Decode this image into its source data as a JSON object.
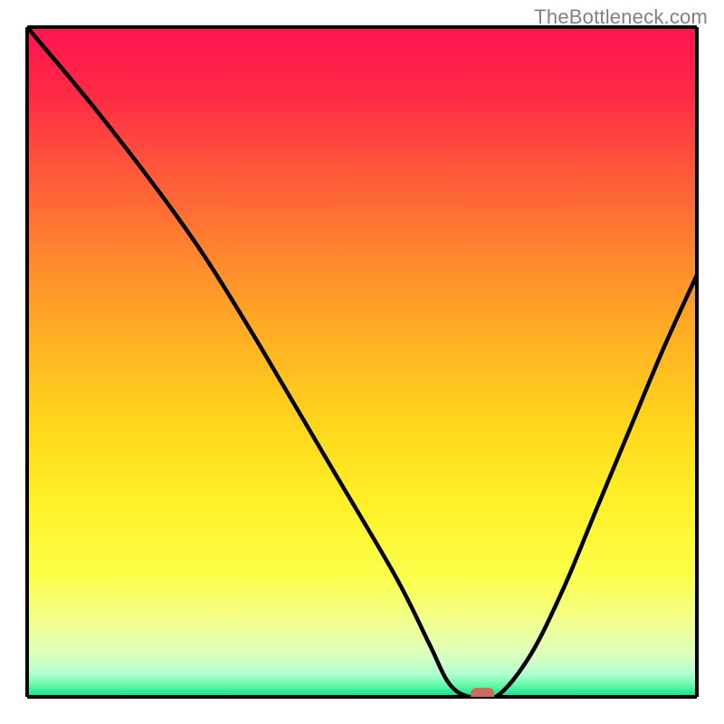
{
  "watermark": "TheBottleneck.com",
  "colors": {
    "curve": "#000000",
    "marker": "#cc6b5f",
    "frame": "#000000"
  },
  "chart_data": {
    "type": "line",
    "title": "",
    "xlabel": "",
    "ylabel": "",
    "xlim": [
      0,
      100
    ],
    "ylim": [
      0,
      100
    ],
    "x": [
      0,
      10,
      20,
      27,
      35,
      45,
      55,
      60,
      63,
      66,
      70,
      75,
      80,
      85,
      90,
      95,
      100
    ],
    "values": [
      100,
      88,
      75,
      65,
      52,
      35,
      18,
      8,
      2,
      0,
      0,
      6,
      16,
      28,
      40,
      52,
      63
    ],
    "marker": {
      "x": 68,
      "y": 0
    },
    "annotations": []
  }
}
